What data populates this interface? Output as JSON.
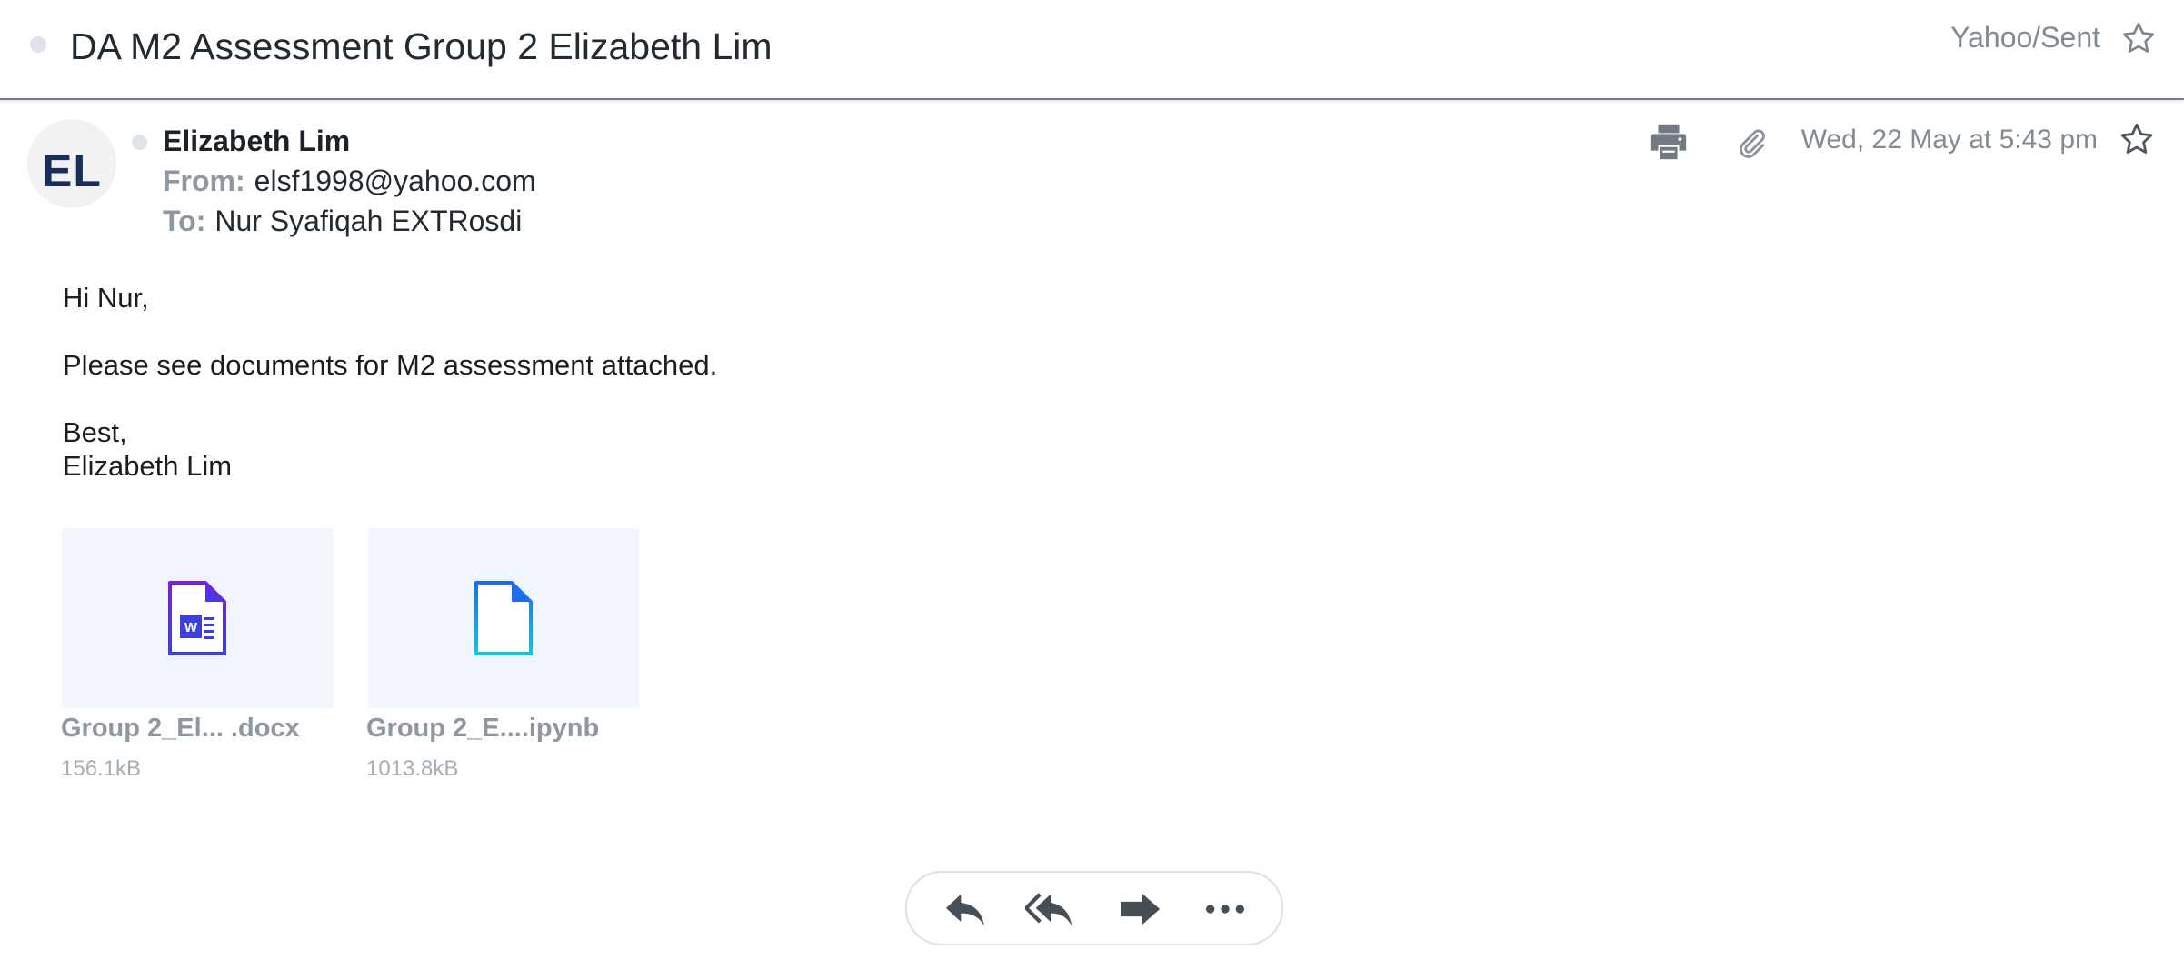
{
  "header": {
    "subject": "DA M2 Assessment Group 2 Elizabeth Lim",
    "folder": "Yahoo/Sent"
  },
  "message": {
    "avatar_initials": "EL",
    "sender_name": "Elizabeth Lim",
    "from_label": "From:",
    "from_value": "elsf1998@yahoo.com",
    "to_label": "To:",
    "to_value": "Nur Syafiqah EXTRosdi",
    "date": "Wed, 22 May at 5:43 pm"
  },
  "body": {
    "greeting": "Hi Nur,",
    "line1": "Please see documents for M2 assessment attached.",
    "signoff": "Best,",
    "signature": "Elizabeth Lim"
  },
  "attachments": [
    {
      "name": "Group 2_El... .docx",
      "size": "156.1kB",
      "icon": "word-doc-icon"
    },
    {
      "name": "Group 2_E....ipynb",
      "size": "1013.8kB",
      "icon": "generic-file-icon"
    }
  ],
  "colors": {
    "muted_text": "#828a93",
    "label_text": "#8f97a1",
    "attachment_bg": "#f0f5fe",
    "word_purple": "#5b2de0",
    "file_cyan": "#12b8e8",
    "action_icon": "#464e56"
  }
}
